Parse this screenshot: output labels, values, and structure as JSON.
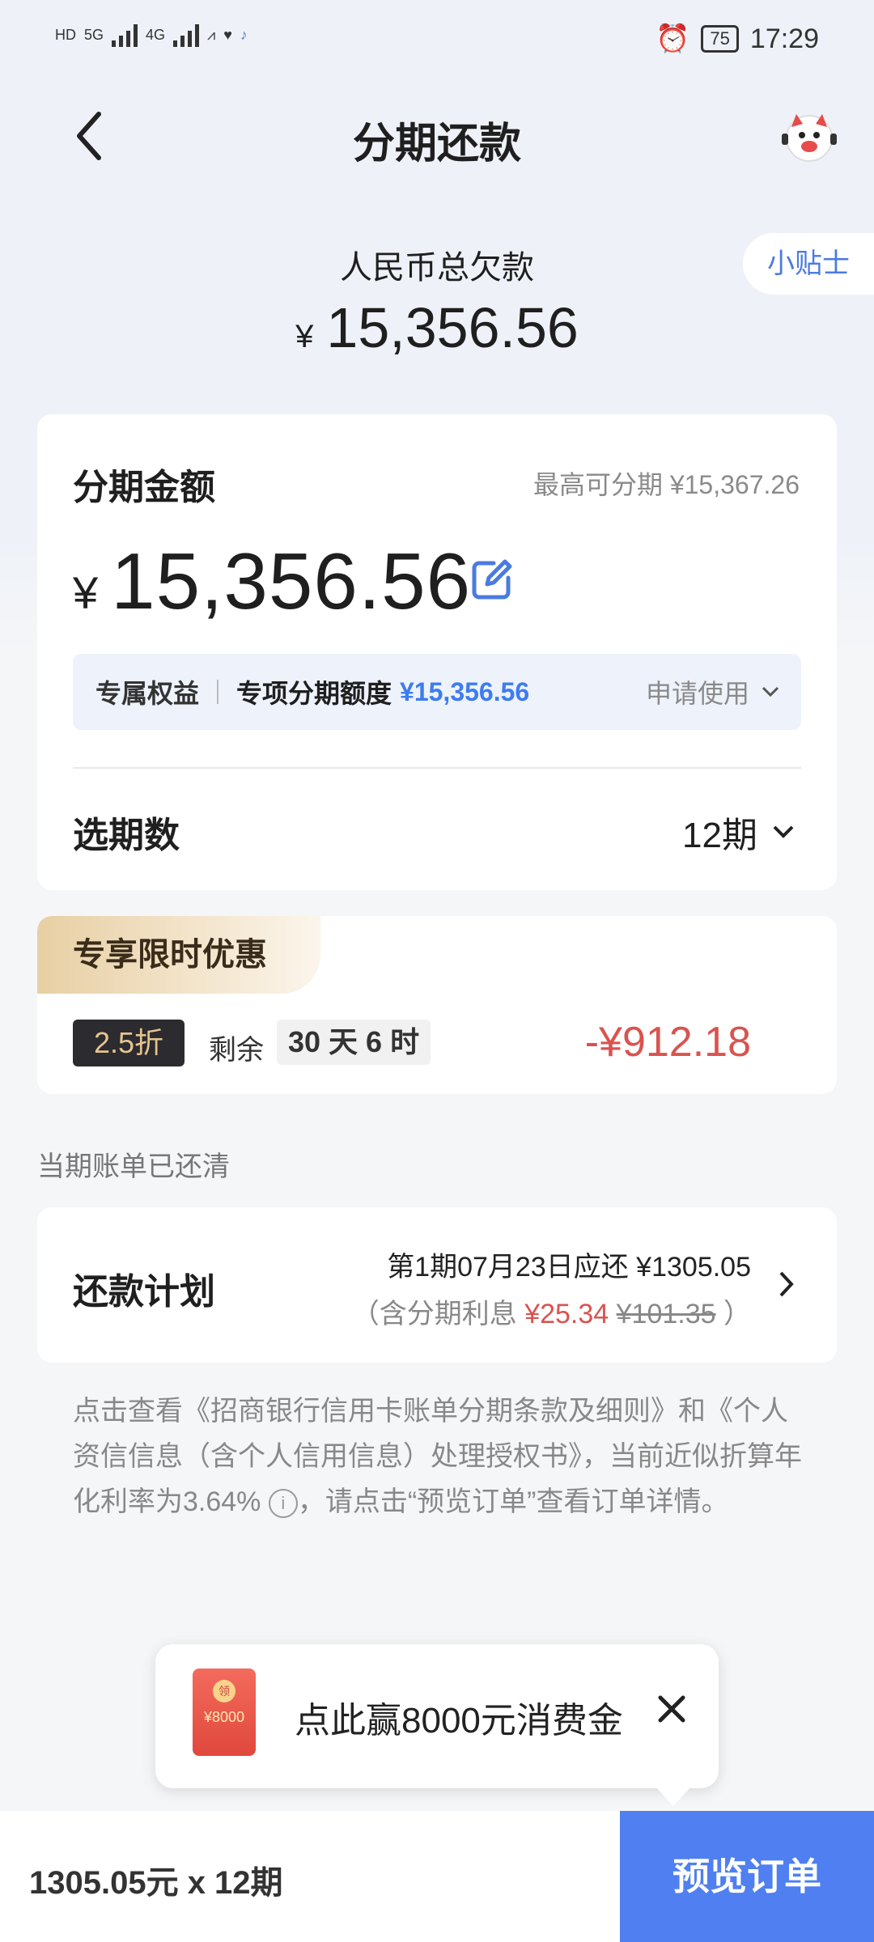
{
  "status_bar": {
    "network_left": "5G",
    "network_right": "4G",
    "battery": "75",
    "time": "17:29"
  },
  "header": {
    "title": "分期还款"
  },
  "debt": {
    "label": "人民币总欠款",
    "currency": "¥",
    "amount": "15,356.56"
  },
  "tips_label": "小贴士",
  "installment": {
    "title": "分期金额",
    "max_label": "最高可分期 ¥15,367.26",
    "currency": "¥",
    "amount": "15,356.56",
    "perk_tag": "专属权益",
    "perk_label": "专项分期额度",
    "perk_amount": "¥15,356.56",
    "perk_action": "申请使用",
    "periods_label": "选期数",
    "periods_value": "12期"
  },
  "promo": {
    "banner": "专享限时优惠",
    "discount": "2.5折",
    "remaining_label": "剩余",
    "remaining_value": "30 天 6 时",
    "saving": "-¥912.18"
  },
  "paid_note": "当期账单已还清",
  "plan": {
    "title": "还款计划",
    "line1": "第1期07月23日应还 ¥1305.05",
    "line2_prefix": "（含分期利息",
    "interest": "¥25.34",
    "original_interest": "¥101.35",
    "line2_suffix": "）"
  },
  "terms": {
    "text_before": "点击查看《招商银行信用卡账单分期条款及细则》和《个人资信信息（含个人信用信息）处理授权书》，当前近似折算年化利率为3.64%",
    "text_after": "，请点击“预览订单”查看订单详情。"
  },
  "toast": {
    "packet_label": "¥8000",
    "text": "点此赢8000元消费金"
  },
  "bottom": {
    "summary": "1305.05元 x 12期",
    "button": "预览订单"
  },
  "colors": {
    "accent_blue": "#4f7ff0",
    "discount_red": "#d9534f",
    "gold": "#e8cfa4"
  }
}
